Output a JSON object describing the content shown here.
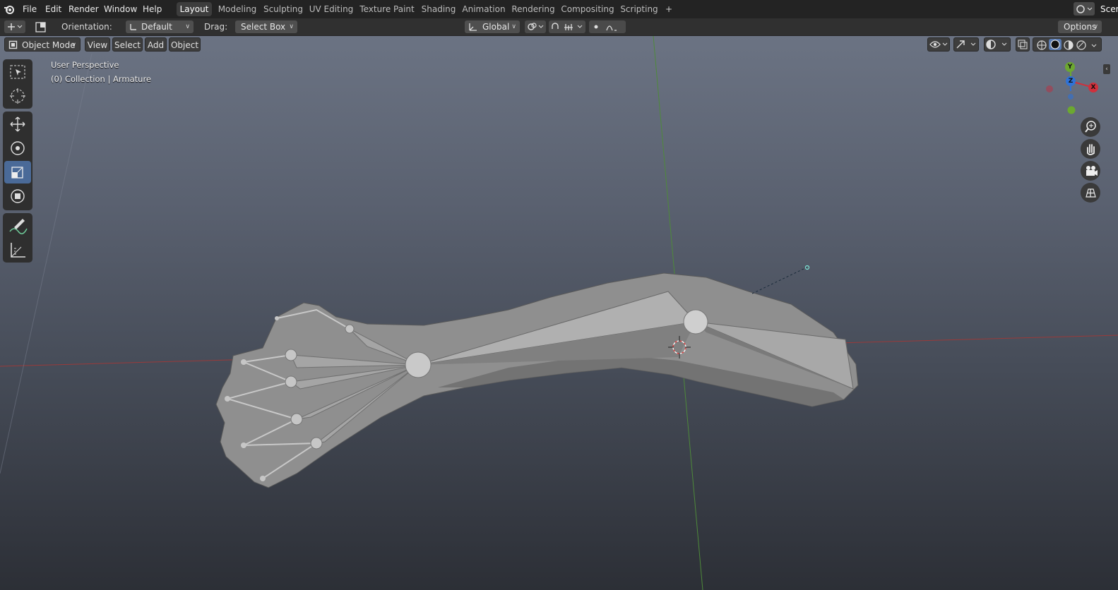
{
  "menubar": {
    "items": [
      "File",
      "Edit",
      "Render",
      "Window",
      "Help"
    ],
    "workspaces": [
      "Layout",
      "Modeling",
      "Sculpting",
      "UV Editing",
      "Texture Paint",
      "Shading",
      "Animation",
      "Rendering",
      "Compositing",
      "Scripting"
    ],
    "active_workspace": "Layout",
    "add_tab": "+",
    "scene_label": "Scen"
  },
  "tool_settings": {
    "orientation_label": "Orientation:",
    "orientation_value": "Default",
    "drag_label": "Drag:",
    "drag_value": "Select Box",
    "transform_orientation": "Global",
    "options_label": "Options"
  },
  "viewport_header": {
    "mode": "Object Mode",
    "menus": [
      "View",
      "Select",
      "Add",
      "Object"
    ]
  },
  "viewport": {
    "view_name": "User Perspective",
    "collection_info": "(0) Collection | Armature"
  },
  "gizmo": {
    "y": "Y",
    "z": "Z",
    "x": "X"
  },
  "colors": {
    "active_tool": "#4a6a98",
    "x_axis": "#d0303c",
    "y_axis": "#6ca830",
    "z_axis": "#2f72d6"
  },
  "icons": {
    "logo": "blender-logo-icon",
    "tools": [
      "select-box-icon",
      "cursor-icon",
      "move-icon",
      "rotate-icon",
      "scale-icon",
      "transform-icon",
      "annotate-icon",
      "measure-icon"
    ],
    "nav": [
      "zoom-icon",
      "pan-hand-icon",
      "camera-view-icon",
      "ortho-grid-icon"
    ]
  }
}
